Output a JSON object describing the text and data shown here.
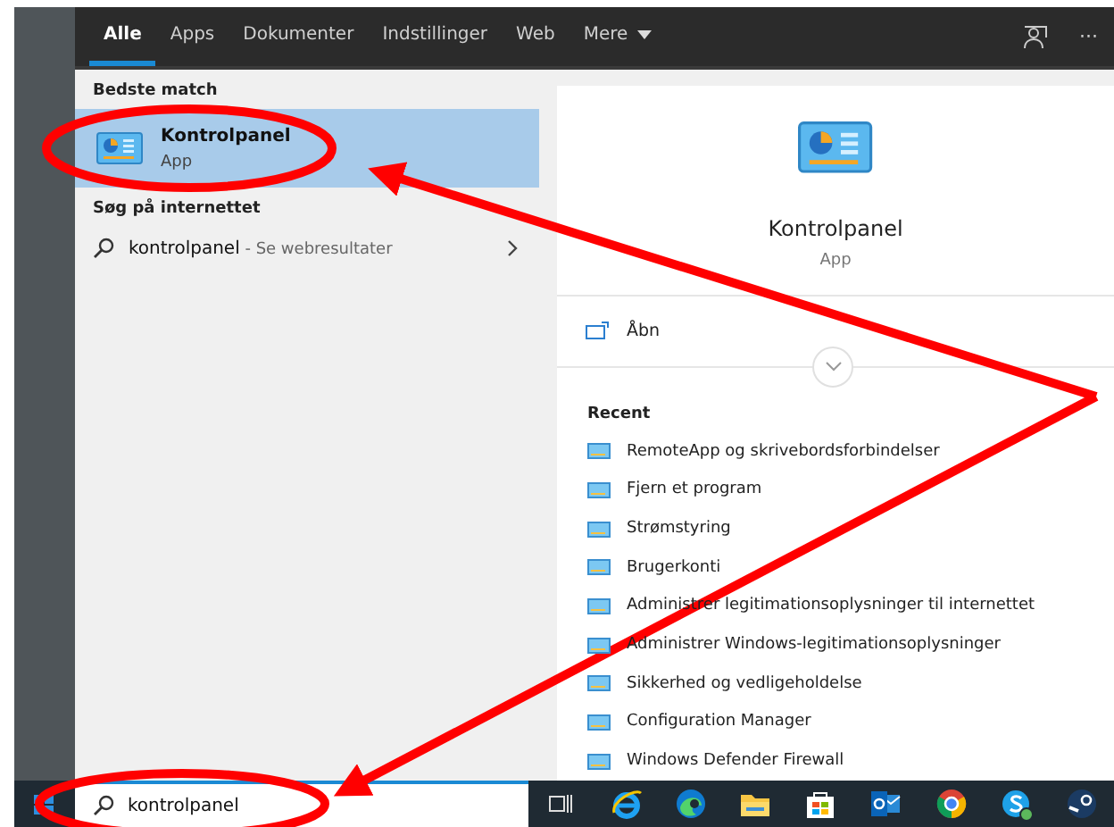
{
  "tabs": [
    {
      "label": "Alle",
      "selected": true
    },
    {
      "label": "Apps",
      "selected": false
    },
    {
      "label": "Dokumenter",
      "selected": false
    },
    {
      "label": "Indstillinger",
      "selected": false
    },
    {
      "label": "Web",
      "selected": false
    },
    {
      "label": "Mere",
      "selected": false,
      "dropdown": true
    }
  ],
  "header_more": "···",
  "best_match": {
    "heading": "Bedste match",
    "items": [
      {
        "title": "Kontrolpanel",
        "subtitle": "App",
        "selected": true
      }
    ]
  },
  "web_search": {
    "heading": "Søg på internettet",
    "items": [
      {
        "query": "kontrolpanel",
        "suffix": " - Se webresultater"
      }
    ]
  },
  "preview": {
    "title": "Kontrolpanel",
    "subtitle": "App",
    "actions": [
      {
        "label": "Åbn"
      }
    ],
    "recent_heading": "Recent",
    "recent": [
      "RemoteApp og skrivebordsforbindelser",
      "Fjern et program",
      "Strømstyring",
      "Brugerkonti",
      "Administrer legitimationsoplysninger til internettet",
      "Administrer Windows-legitimationsoplysninger",
      "Sikkerhed og vedligeholdelse",
      "Configuration Manager",
      "Windows Defender Firewall"
    ]
  },
  "search_box": {
    "value": "kontrolpanel"
  },
  "taskbar": [
    {
      "kind": "taskview"
    },
    {
      "kind": "ie"
    },
    {
      "kind": "edge"
    },
    {
      "kind": "folder"
    },
    {
      "kind": "store"
    },
    {
      "kind": "outlook"
    },
    {
      "kind": "chrome"
    },
    {
      "kind": "skype"
    },
    {
      "kind": "steam"
    }
  ]
}
